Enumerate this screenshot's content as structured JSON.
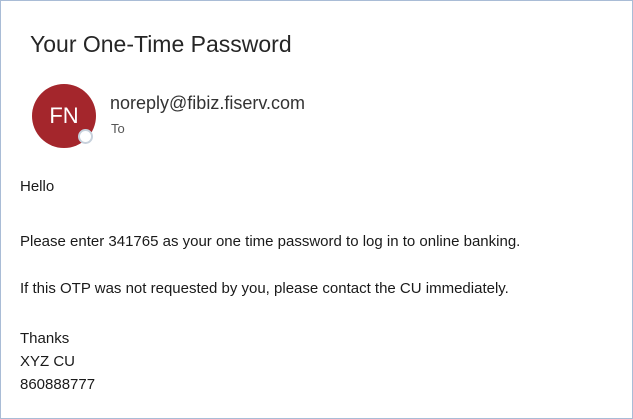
{
  "email": {
    "subject": "Your One-Time Password",
    "avatar_initials": "FN",
    "avatar_color": "#a4262c",
    "sender": "noreply@fibiz.fiserv.com",
    "to_label": "To",
    "body": {
      "greeting": "Hello",
      "otp_line": "Please enter 341765 as your one time password to log in to online banking.",
      "warning_line": "If this OTP was not requested by you, please contact the CU immediately.",
      "signoff": "Thanks",
      "org_name": "XYZ CU",
      "phone": "860888777"
    }
  }
}
